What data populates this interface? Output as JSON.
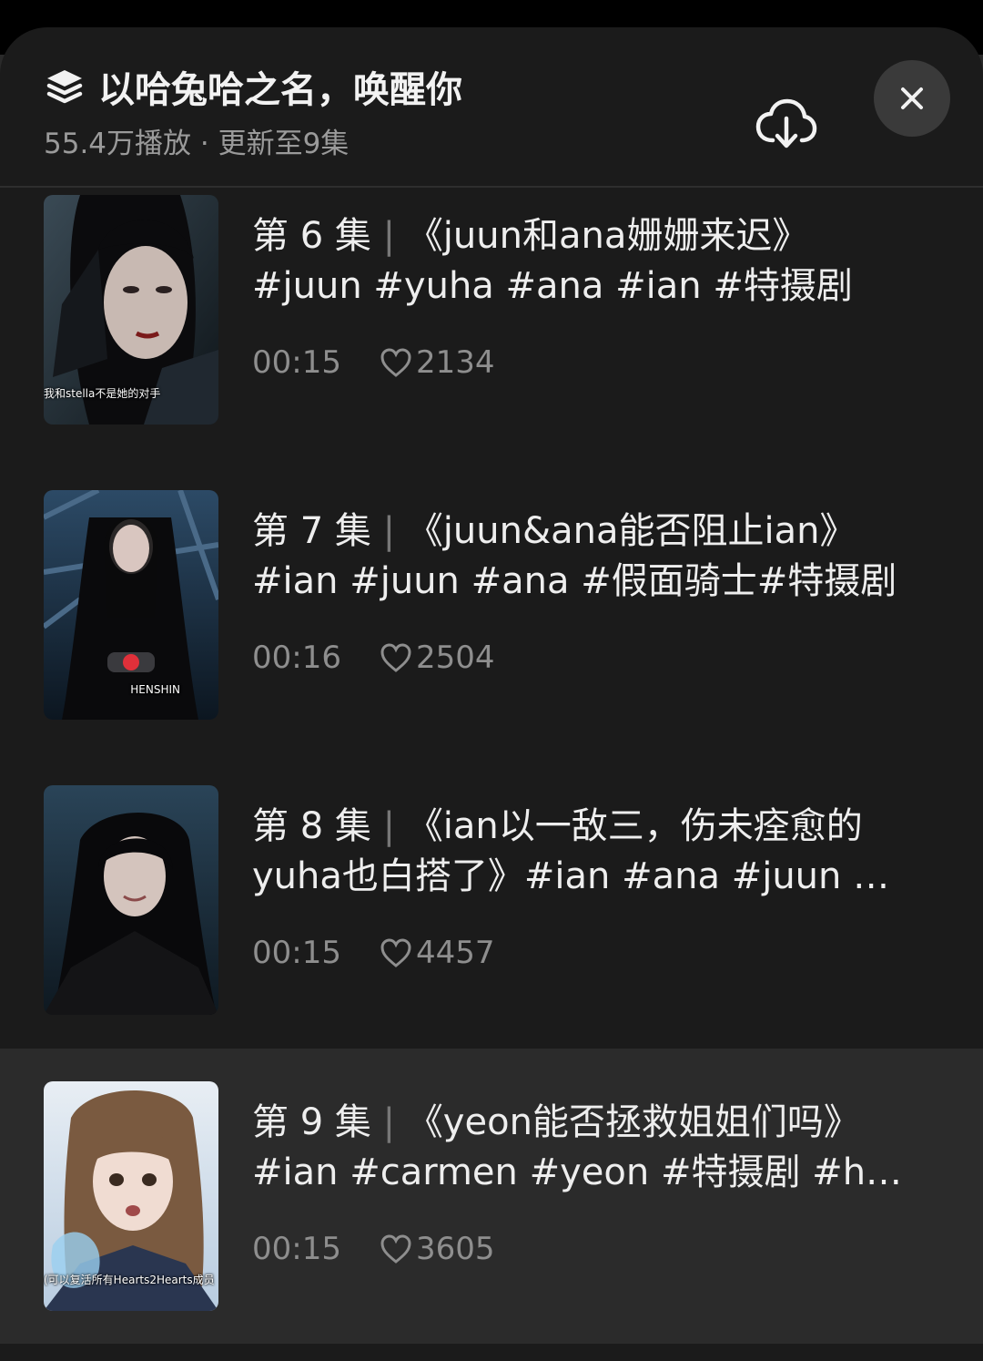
{
  "header": {
    "title": "以哈兔哈之名，唤醒你",
    "subtitle": "55.4万播放 · 更新至9集",
    "icons": {
      "collection": "layers-icon",
      "download": "cloud-download-icon",
      "close": "close-icon"
    }
  },
  "episodes": [
    {
      "label": "第 6 集",
      "separator": "|",
      "title_line1": "《juun和ana姗姗来迟》",
      "title_line2": "#juun #yuha #ana #ian #特摄剧",
      "duration": "00:15",
      "likes": "2134",
      "thumb_caption": "我和stella不是她的对手",
      "active": false
    },
    {
      "label": "第 7 集",
      "separator": "|",
      "title_line1": "《juun&ana能否阻止ian》",
      "title_line2": "#ian #juun #ana #假面骑士#特摄剧",
      "duration": "00:16",
      "likes": "2504",
      "thumb_caption": "HENSHIN",
      "active": false
    },
    {
      "label": "第 8 集",
      "separator": "|",
      "title_line1": "《ian以一敌三，伤未痊愈的",
      "title_line2": "yuha也白搭了》#ian #ana #juun …",
      "duration": "00:15",
      "likes": "4457",
      "thumb_caption": "",
      "active": false
    },
    {
      "label": "第 9 集",
      "separator": "|",
      "title_line1": "《yeon能否拯救姐姐们吗》",
      "title_line2": "#ian #carmen #yeon #特摄剧  #h…",
      "duration": "00:15",
      "likes": "3605",
      "thumb_caption": "(可以复活所有Hearts2Hearts成员",
      "active": true
    }
  ],
  "colors": {
    "sheet_bg": "#1b1b1b",
    "active_row_bg": "#2b2b2b",
    "title_text": "#eeeeee",
    "meta_text": "#8e8e8e",
    "close_btn_bg": "#3a3a3a"
  }
}
